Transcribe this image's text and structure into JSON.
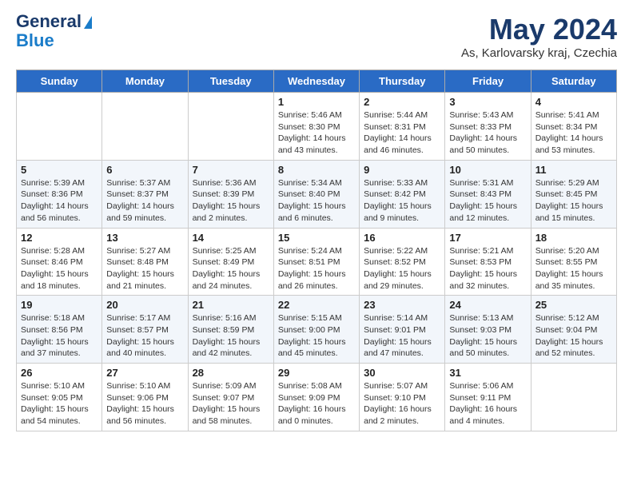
{
  "header": {
    "logo_line1": "General",
    "logo_line2": "Blue",
    "month_title": "May 2024",
    "location": "As, Karlovarsky kraj, Czechia"
  },
  "weekdays": [
    "Sunday",
    "Monday",
    "Tuesday",
    "Wednesday",
    "Thursday",
    "Friday",
    "Saturday"
  ],
  "weeks": [
    [
      {
        "day": "",
        "info": ""
      },
      {
        "day": "",
        "info": ""
      },
      {
        "day": "",
        "info": ""
      },
      {
        "day": "1",
        "info": "Sunrise: 5:46 AM\nSunset: 8:30 PM\nDaylight: 14 hours\nand 43 minutes."
      },
      {
        "day": "2",
        "info": "Sunrise: 5:44 AM\nSunset: 8:31 PM\nDaylight: 14 hours\nand 46 minutes."
      },
      {
        "day": "3",
        "info": "Sunrise: 5:43 AM\nSunset: 8:33 PM\nDaylight: 14 hours\nand 50 minutes."
      },
      {
        "day": "4",
        "info": "Sunrise: 5:41 AM\nSunset: 8:34 PM\nDaylight: 14 hours\nand 53 minutes."
      }
    ],
    [
      {
        "day": "5",
        "info": "Sunrise: 5:39 AM\nSunset: 8:36 PM\nDaylight: 14 hours\nand 56 minutes."
      },
      {
        "day": "6",
        "info": "Sunrise: 5:37 AM\nSunset: 8:37 PM\nDaylight: 14 hours\nand 59 minutes."
      },
      {
        "day": "7",
        "info": "Sunrise: 5:36 AM\nSunset: 8:39 PM\nDaylight: 15 hours\nand 2 minutes."
      },
      {
        "day": "8",
        "info": "Sunrise: 5:34 AM\nSunset: 8:40 PM\nDaylight: 15 hours\nand 6 minutes."
      },
      {
        "day": "9",
        "info": "Sunrise: 5:33 AM\nSunset: 8:42 PM\nDaylight: 15 hours\nand 9 minutes."
      },
      {
        "day": "10",
        "info": "Sunrise: 5:31 AM\nSunset: 8:43 PM\nDaylight: 15 hours\nand 12 minutes."
      },
      {
        "day": "11",
        "info": "Sunrise: 5:29 AM\nSunset: 8:45 PM\nDaylight: 15 hours\nand 15 minutes."
      }
    ],
    [
      {
        "day": "12",
        "info": "Sunrise: 5:28 AM\nSunset: 8:46 PM\nDaylight: 15 hours\nand 18 minutes."
      },
      {
        "day": "13",
        "info": "Sunrise: 5:27 AM\nSunset: 8:48 PM\nDaylight: 15 hours\nand 21 minutes."
      },
      {
        "day": "14",
        "info": "Sunrise: 5:25 AM\nSunset: 8:49 PM\nDaylight: 15 hours\nand 24 minutes."
      },
      {
        "day": "15",
        "info": "Sunrise: 5:24 AM\nSunset: 8:51 PM\nDaylight: 15 hours\nand 26 minutes."
      },
      {
        "day": "16",
        "info": "Sunrise: 5:22 AM\nSunset: 8:52 PM\nDaylight: 15 hours\nand 29 minutes."
      },
      {
        "day": "17",
        "info": "Sunrise: 5:21 AM\nSunset: 8:53 PM\nDaylight: 15 hours\nand 32 minutes."
      },
      {
        "day": "18",
        "info": "Sunrise: 5:20 AM\nSunset: 8:55 PM\nDaylight: 15 hours\nand 35 minutes."
      }
    ],
    [
      {
        "day": "19",
        "info": "Sunrise: 5:18 AM\nSunset: 8:56 PM\nDaylight: 15 hours\nand 37 minutes."
      },
      {
        "day": "20",
        "info": "Sunrise: 5:17 AM\nSunset: 8:57 PM\nDaylight: 15 hours\nand 40 minutes."
      },
      {
        "day": "21",
        "info": "Sunrise: 5:16 AM\nSunset: 8:59 PM\nDaylight: 15 hours\nand 42 minutes."
      },
      {
        "day": "22",
        "info": "Sunrise: 5:15 AM\nSunset: 9:00 PM\nDaylight: 15 hours\nand 45 minutes."
      },
      {
        "day": "23",
        "info": "Sunrise: 5:14 AM\nSunset: 9:01 PM\nDaylight: 15 hours\nand 47 minutes."
      },
      {
        "day": "24",
        "info": "Sunrise: 5:13 AM\nSunset: 9:03 PM\nDaylight: 15 hours\nand 50 minutes."
      },
      {
        "day": "25",
        "info": "Sunrise: 5:12 AM\nSunset: 9:04 PM\nDaylight: 15 hours\nand 52 minutes."
      }
    ],
    [
      {
        "day": "26",
        "info": "Sunrise: 5:10 AM\nSunset: 9:05 PM\nDaylight: 15 hours\nand 54 minutes."
      },
      {
        "day": "27",
        "info": "Sunrise: 5:10 AM\nSunset: 9:06 PM\nDaylight: 15 hours\nand 56 minutes."
      },
      {
        "day": "28",
        "info": "Sunrise: 5:09 AM\nSunset: 9:07 PM\nDaylight: 15 hours\nand 58 minutes."
      },
      {
        "day": "29",
        "info": "Sunrise: 5:08 AM\nSunset: 9:09 PM\nDaylight: 16 hours\nand 0 minutes."
      },
      {
        "day": "30",
        "info": "Sunrise: 5:07 AM\nSunset: 9:10 PM\nDaylight: 16 hours\nand 2 minutes."
      },
      {
        "day": "31",
        "info": "Sunrise: 5:06 AM\nSunset: 9:11 PM\nDaylight: 16 hours\nand 4 minutes."
      },
      {
        "day": "",
        "info": ""
      }
    ]
  ]
}
